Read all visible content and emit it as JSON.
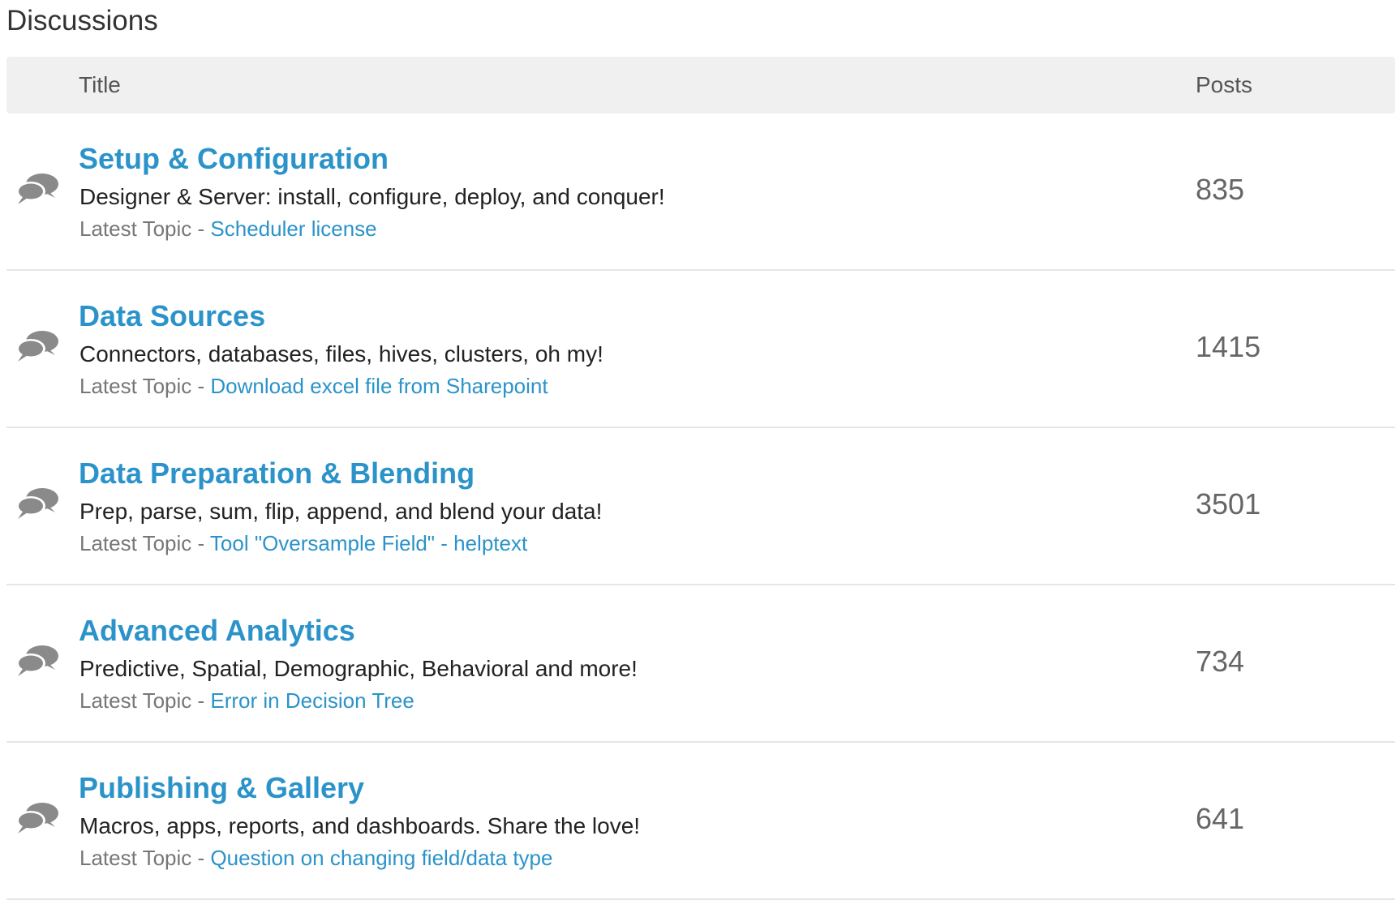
{
  "page": {
    "heading": "Discussions"
  },
  "table": {
    "headers": {
      "title": "Title",
      "posts": "Posts"
    },
    "latest_label": "Latest Topic - ",
    "rows": [
      {
        "title": "Setup & Configuration",
        "description": "Designer & Server: install, configure, deploy, and conquer!",
        "latest_topic": "Scheduler license",
        "posts": "835",
        "icon": "speech-bubbles-icon"
      },
      {
        "title": "Data Sources",
        "description": "Connectors, databases, files, hives, clusters, oh my!",
        "latest_topic": "Download excel file from Sharepoint",
        "posts": "1415",
        "icon": "speech-bubbles-icon"
      },
      {
        "title": "Data Preparation & Blending",
        "description": "Prep, parse, sum, flip, append, and blend your data!",
        "latest_topic": "Tool \"Oversample Field\" - helptext",
        "posts": "3501",
        "icon": "speech-bubbles-icon"
      },
      {
        "title": "Advanced Analytics",
        "description": "Predictive, Spatial, Demographic, Behavioral and more!",
        "latest_topic": "Error in Decision Tree",
        "posts": "734",
        "icon": "speech-bubbles-icon"
      },
      {
        "title": "Publishing & Gallery",
        "description": "Macros, apps, reports, and dashboards. Share the love!",
        "latest_topic": "Question on changing field/data type",
        "posts": "641",
        "icon": "speech-bubbles-icon"
      }
    ]
  },
  "colors": {
    "link": "#2b93c9",
    "header_bg": "#f0f0f0",
    "icon": "#8a8a8a"
  }
}
